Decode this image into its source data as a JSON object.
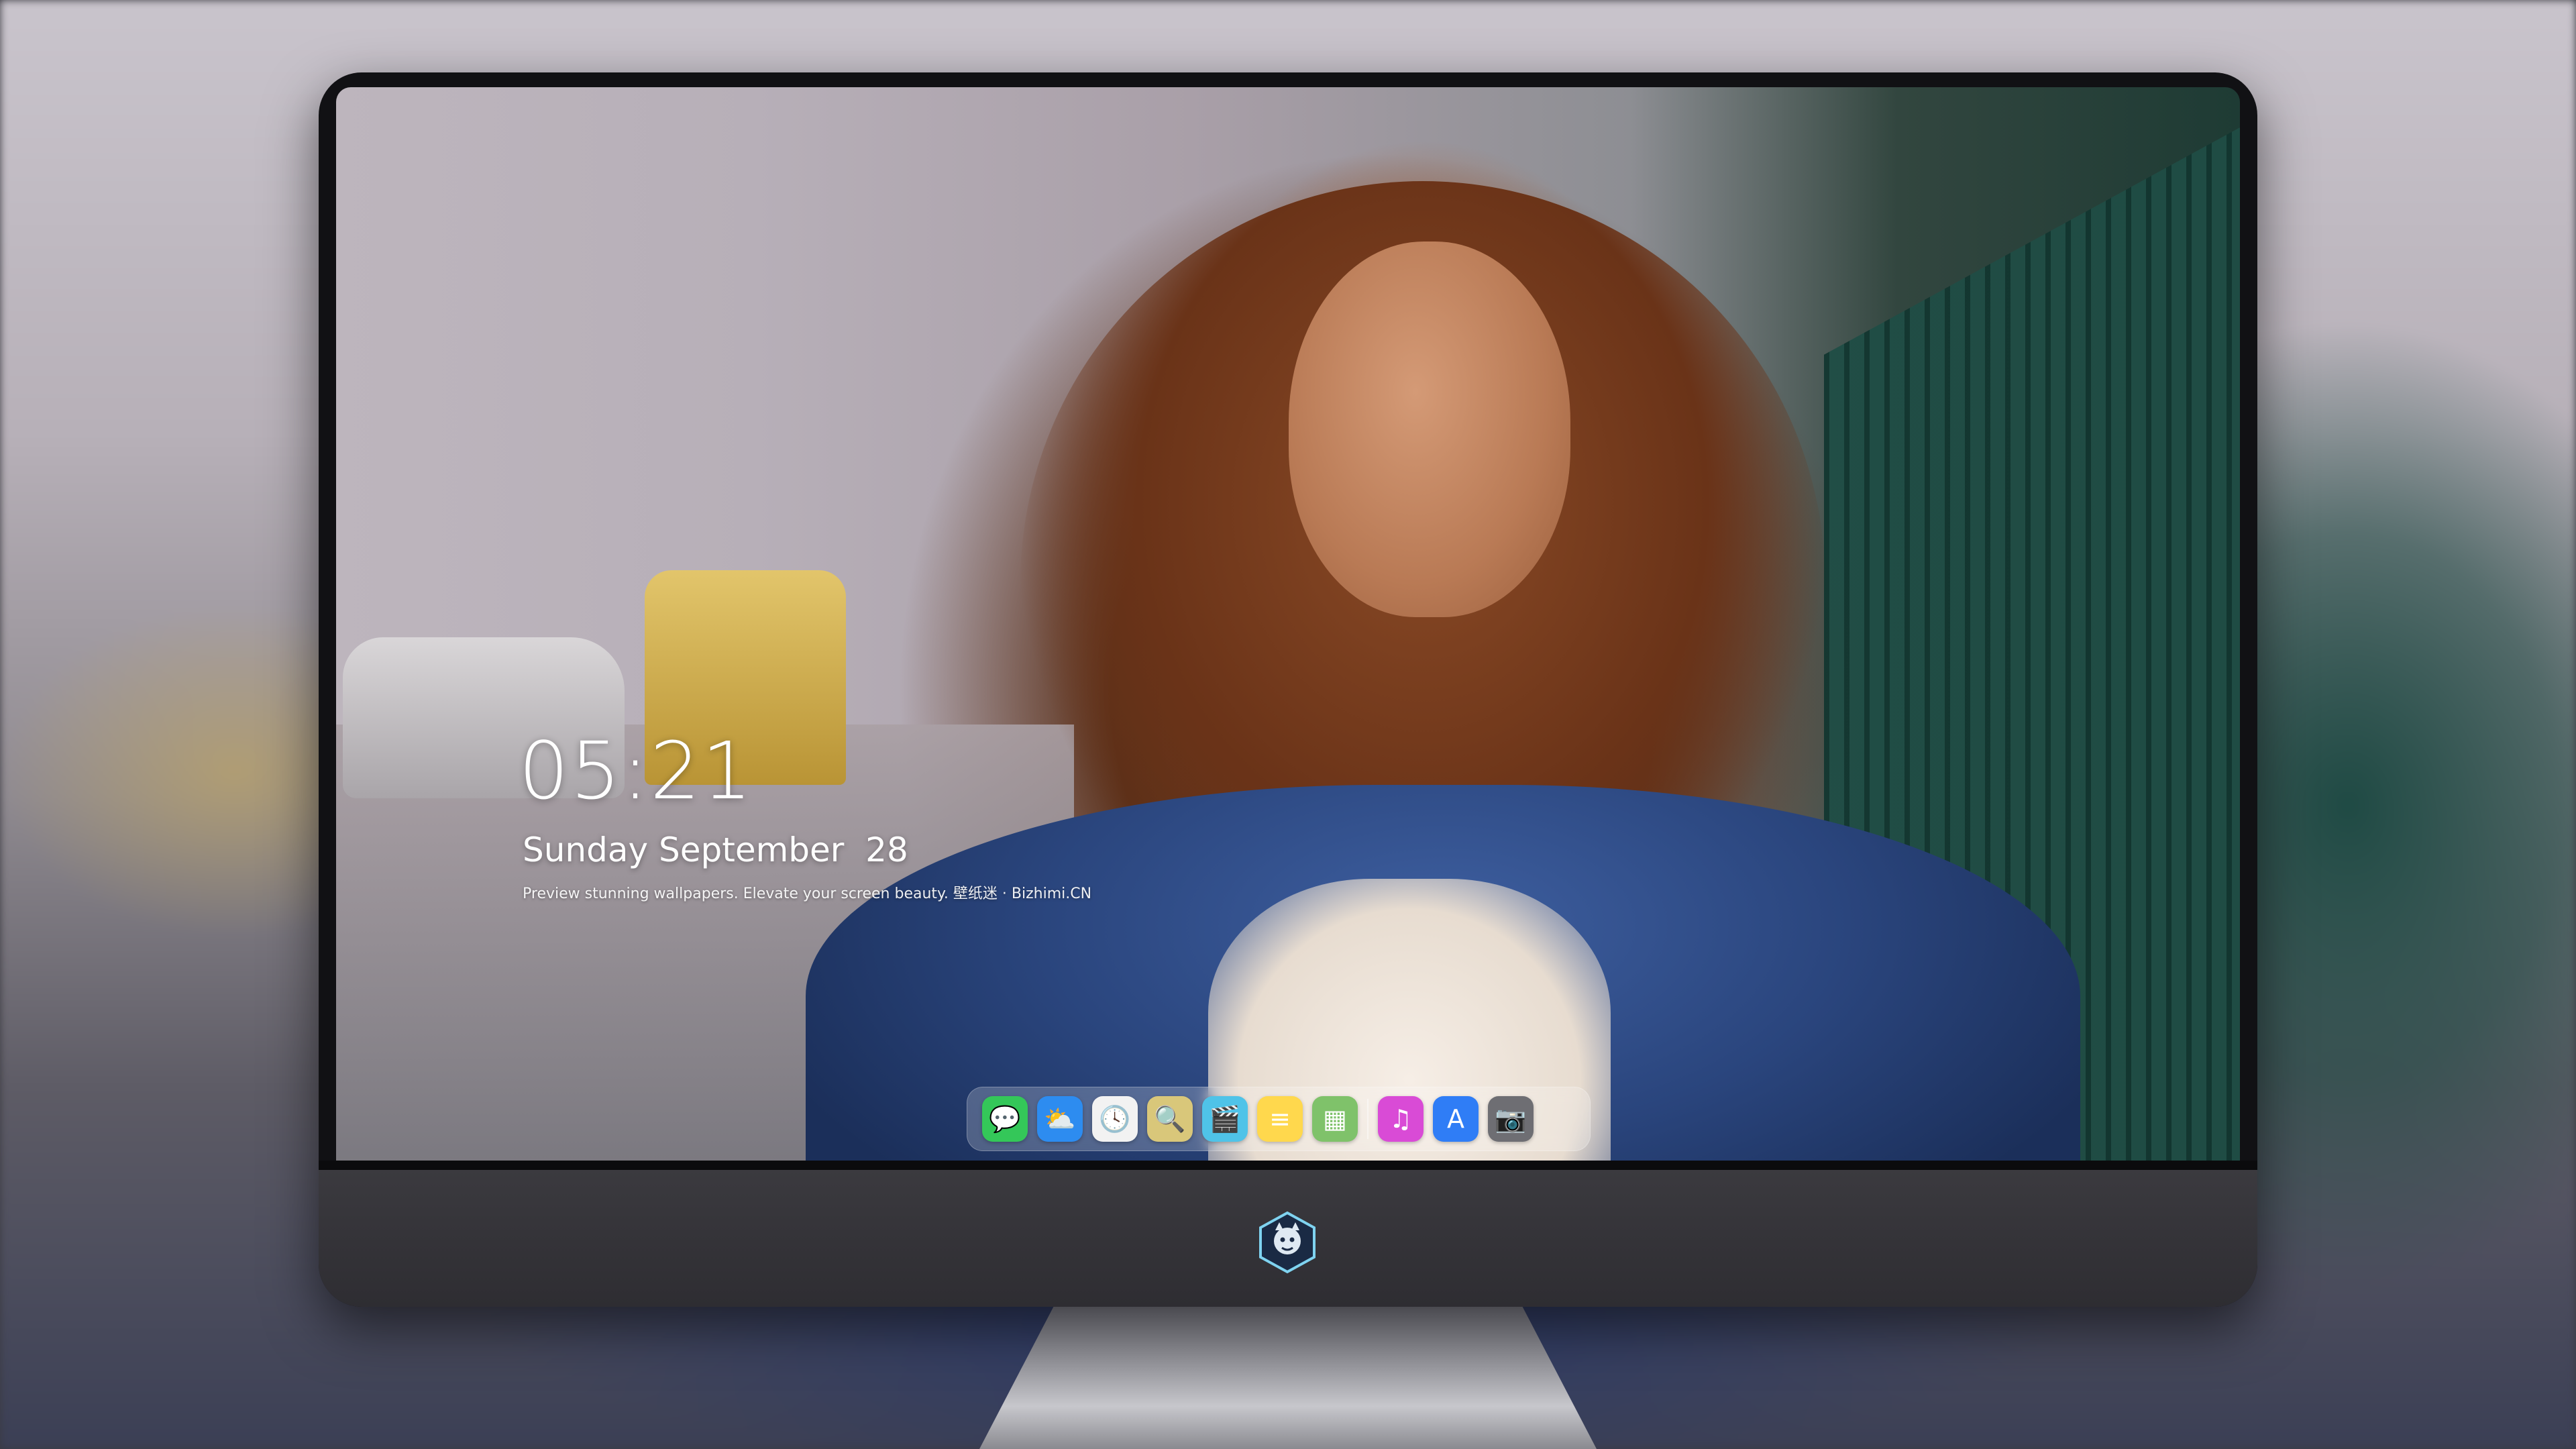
{
  "lockscreen": {
    "time": "05:21",
    "date": "Sunday September  28",
    "tagline": "Preview stunning wallpapers. Elevate your screen beauty. 壁纸迷 · Bizhimi.CN"
  },
  "dock": {
    "apps": [
      {
        "name": "messages-icon",
        "color": "#34c759",
        "glyph": "💬"
      },
      {
        "name": "weather-icon",
        "color": "#2d8cf0",
        "glyph": "⛅"
      },
      {
        "name": "clock-icon",
        "color": "#f2f2f2",
        "glyph": "🕓"
      },
      {
        "name": "preview-icon",
        "color": "#d9c77a",
        "glyph": "🔍"
      },
      {
        "name": "video-editor-icon",
        "color": "#4fc3e8",
        "glyph": "🎬"
      },
      {
        "name": "notes-icon",
        "color": "#ffd84d",
        "glyph": "≡"
      },
      {
        "name": "photo-booth-icon",
        "color": "#7fc26a",
        "glyph": "▦"
      },
      {
        "name": "music-icon",
        "color": "#d94bd6",
        "glyph": "♫"
      },
      {
        "name": "app-store-icon",
        "color": "#2f7df6",
        "glyph": "A"
      },
      {
        "name": "camera-icon",
        "color": "#6e6e73",
        "glyph": "📷"
      }
    ]
  },
  "colors": {
    "monitor_frame": "#111114",
    "chin": "#3b3a3f",
    "text": "#ffffff"
  }
}
